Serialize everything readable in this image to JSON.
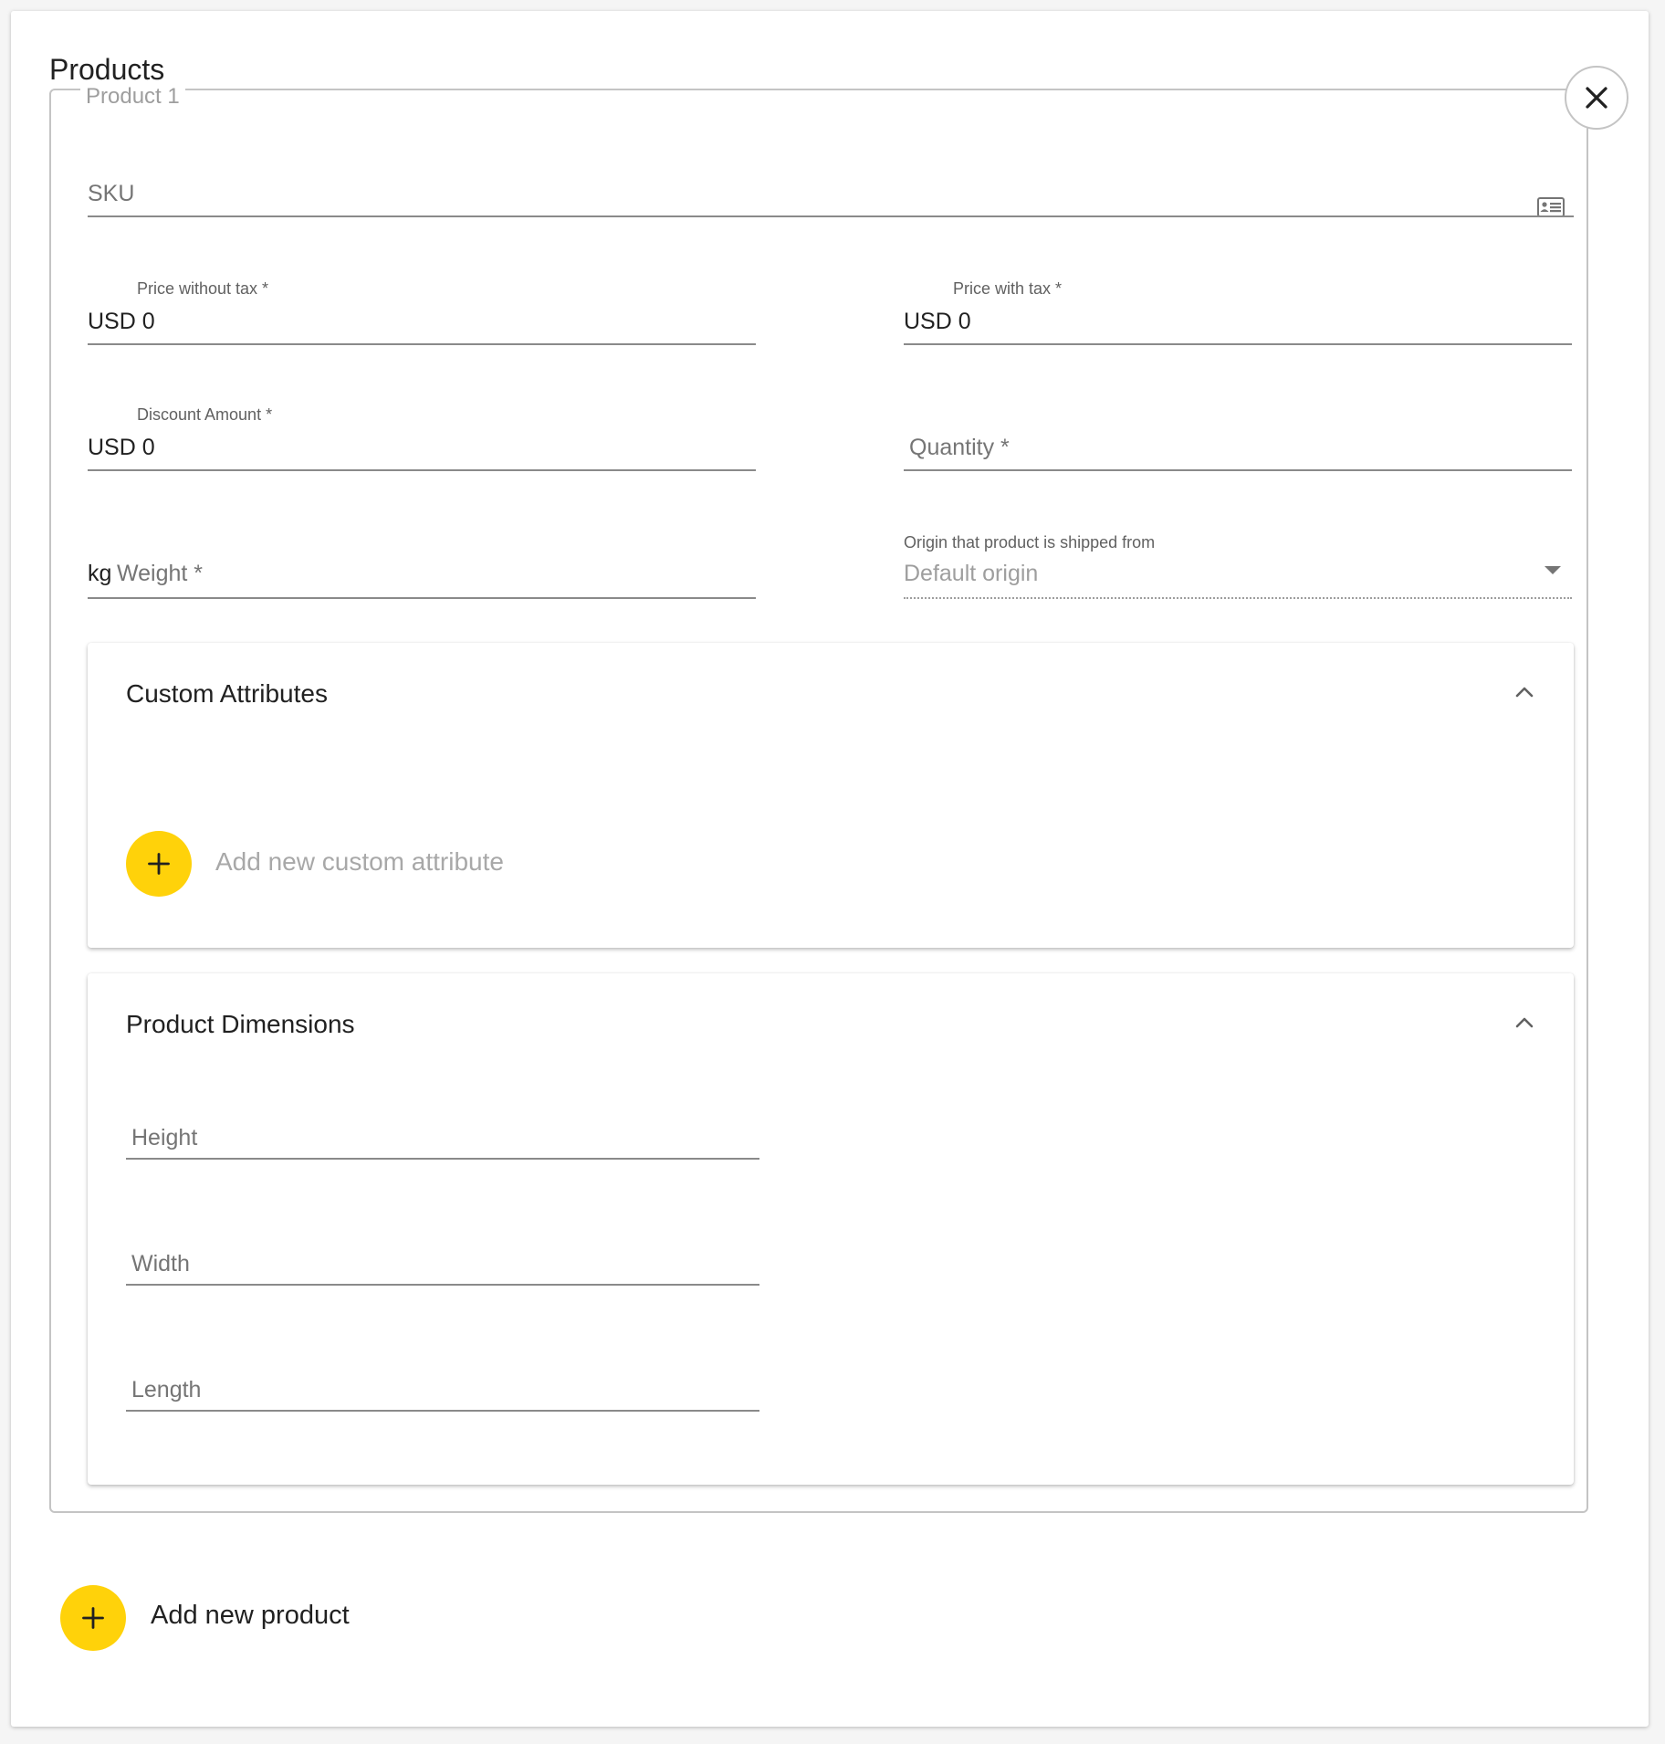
{
  "header": {
    "title": "Products"
  },
  "product": {
    "legend": "Product 1",
    "sku": {
      "placeholder": "SKU",
      "icon": "id-card-icon"
    },
    "price_without_tax": {
      "label": "Price without tax *",
      "value": "USD 0"
    },
    "price_with_tax": {
      "label": "Price with tax *",
      "value": "USD 0"
    },
    "discount_amount": {
      "label": "Discount Amount *",
      "value": "USD 0"
    },
    "quantity": {
      "placeholder": "Quantity *"
    },
    "weight": {
      "prefix": "kg",
      "placeholder": "Weight *"
    },
    "origin": {
      "label": "Origin that product is shipped from",
      "value": "Default origin"
    }
  },
  "custom_attributes": {
    "title": "Custom Attributes",
    "add_label": "Add new custom attribute"
  },
  "dimensions": {
    "title": "Product Dimensions",
    "height_placeholder": "Height",
    "width_placeholder": "Width",
    "length_placeholder": "Length"
  },
  "footer": {
    "add_product_label": "Add new product"
  },
  "colors": {
    "accent": "#ffd20a",
    "border": "#c4c4c4",
    "muted_text": "#9e9e9e"
  }
}
